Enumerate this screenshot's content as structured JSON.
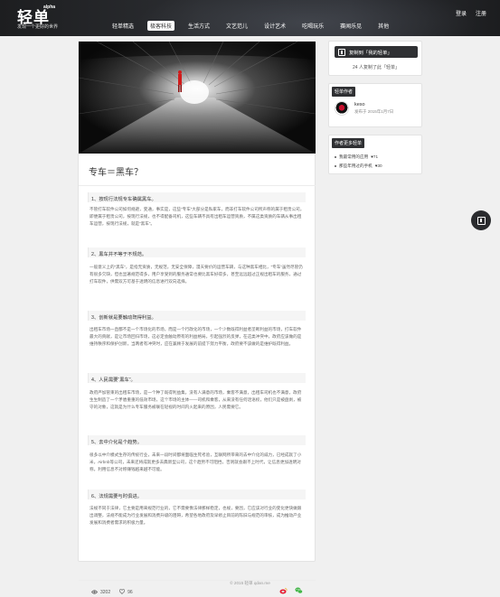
{
  "header": {
    "logo": "轻单",
    "logo_tag": "alpha",
    "slogan": "发现一个更好的世界",
    "nav": [
      "轻单精选",
      "极客科技",
      "生活方式",
      "文艺范儿",
      "设计艺术",
      "吃喝玩乐",
      "赛闻乐见",
      "其他"
    ],
    "active_nav": "极客科技",
    "login": "登录",
    "register": "注册"
  },
  "article": {
    "title": "专车＝黑车？",
    "sections": [
      {
        "heading": "1、按现行法规专车确属黑车。",
        "body": "不管打车软件公司如何规避，变通，事实是，这些“专车”大部分是私家车，而非打车软件公司所声称的属于租赁公司，即便属于租赁公司，按现行法规，也不得配备司机，这些车辆不具有出租车运营资质，不属这类资质的车辆从事出租车运营，按现行法规，就是“黑车”。"
      },
      {
        "heading": "2、黑车并不等于不规范。",
        "body": "一般意义上的“黑车”，是指无资质，无规范，无安全保障，漫天要价的运营车辆，与这种黑车相比，“专车”虽然尽管仍有很多欠缺，但也显著规范得多，用户享受到的服务通常也要比黑车好得多，甚至远远超过正规出租车的服务，通过打车软件，供需双方可基于透明的信息进行双向选择。"
      },
      {
        "heading": "3、创新就是要触动既得利益。",
        "body": "出租车市场一直都不是一个市场化的市场，而是一个行政化的市场，一个少数既得利益者垄断利益的市场，打车软件最大的贡献，是让市场回归市场，这必定会触动原有的利益格局，引起强烈的反弹，在这类冲突中，政府应该做的是维持秩序和保护创新，当两者有冲突时，应在兼顾于发展的前提下努力平衡，政府要不该做的是维护既得利益。"
      },
      {
        "heading": "4、人民需要“黑车”。",
        "body": "政府严加管束的出租车市场，是一个种了既得利益集，没有人满意的市场，乘客不满意，出租车司机也不满意，政府生生制造了一个矛盾重重的低效市场，这个市场的主体——司机和乘客，从来没有任何话语权，他们只是被盘剥，被守的对象，这就是为什么专车服务被联在轻视的时间内火起来的原因，人民需要它。"
      },
      {
        "heading": "5、去中介化是个趋势。",
        "body": "很多以中介模式生存的传统行业，未来一段时间都将面临生死考验，互联网所带来的去中介化的威力，已经成就了小米，Airbnb等公司，未来还将成就更多去典新型公司，这个趋势不可阻挡，否则就会跟不上时代，让信息更加透明对称，利用信息不对称赚钱越来越不可能。"
      },
      {
        "heading": "6、法规需要与时俱进。",
        "body": "法规不同于法律，它主要是用来规范行业的，它不需要像法律那样稳定，也规，要因，它应该对行业的变化更快做跟出调整，法规不能成为行业发展和消费升级的阻碍，希望各地政府及早修止目前的陈旧与规范的审核，成为推动产业发展和消费者需求的积极力量。"
      }
    ],
    "views": "3202",
    "likes": "96"
  },
  "sidebar": {
    "copy_button": "复制到「我的轻单」",
    "copy_count": "24 人复制了此「轻单」",
    "author_heading": "轻单作者",
    "author_name": "keso",
    "author_date": "发布于 2015年1月7日",
    "more_heading": "作者更多轻单",
    "more_items": [
      {
        "title": "我最常用的应用",
        "likes": "71"
      },
      {
        "title": "那些年用过的手机",
        "likes": "30"
      }
    ]
  },
  "footer": "© 2015 轻单 qdan.me",
  "colors": {
    "header_bg": "#2b2d31",
    "dark_button": "#2f3033",
    "weibo": "#e6162d",
    "wechat": "#44b549"
  }
}
